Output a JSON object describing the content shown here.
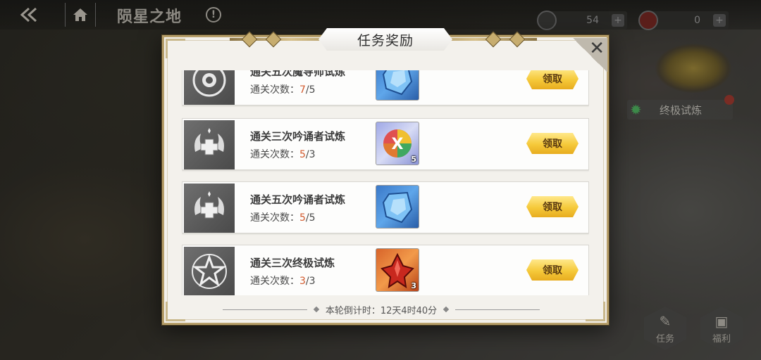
{
  "header": {
    "page_title": "陨星之地",
    "info_glyph": "!",
    "currencies": [
      {
        "value": "54",
        "plus": "+"
      },
      {
        "value": "0",
        "plus": "+"
      }
    ]
  },
  "side": {
    "ultimate_trial_label": "终极试炼",
    "task_button_label": "任务",
    "welfare_button_label": "福利"
  },
  "modal": {
    "title": "任务奖励",
    "close_glyph": "✕",
    "countdown": "本轮倒计时：12天4时40分",
    "tasks": [
      {
        "name": "通关五次魔导师试炼",
        "progress_label": "通关次数：",
        "current": "7",
        "target": "/5",
        "reward_qty": "",
        "claim_label": "领取"
      },
      {
        "name": "通关三次吟诵者试炼",
        "progress_label": "通关次数：",
        "current": "5",
        "target": "/3",
        "reward_qty": "5",
        "claim_label": "领取"
      },
      {
        "name": "通关五次吟诵者试炼",
        "progress_label": "通关次数：",
        "current": "5",
        "target": "/5",
        "reward_qty": "",
        "claim_label": "领取"
      },
      {
        "name": "通关三次终极试炼",
        "progress_label": "通关次数：",
        "current": "3",
        "target": "/3",
        "reward_qty": "3",
        "claim_label": "领取"
      }
    ]
  },
  "colors": {
    "accent_gold": "#f5c93a",
    "progress_current": "#d25a2e",
    "frame_gold": "#b79f6a"
  }
}
